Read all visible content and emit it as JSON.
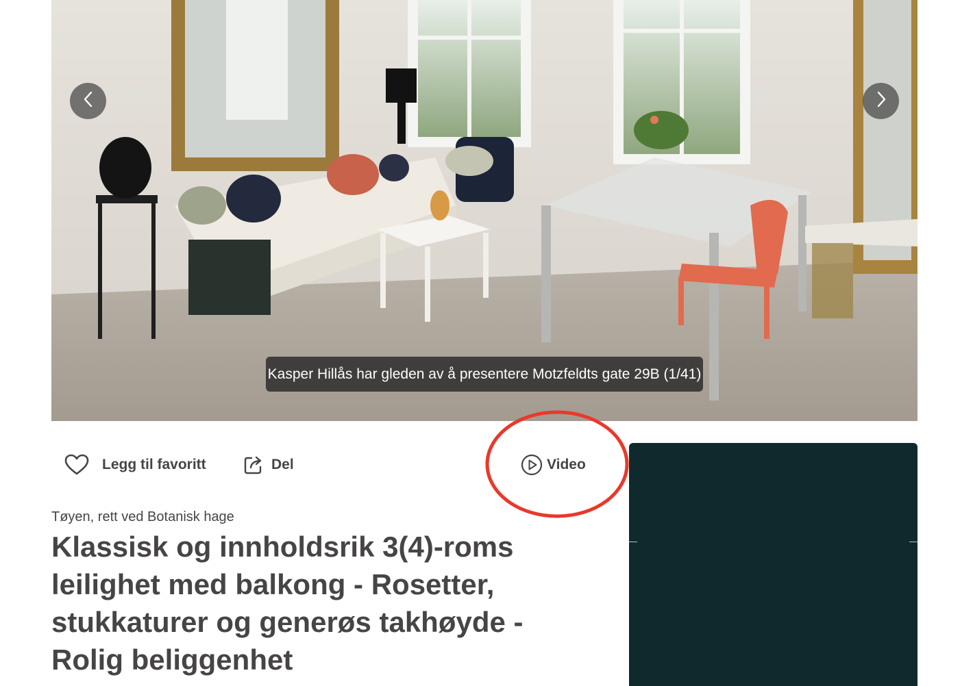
{
  "gallery": {
    "caption": "Kasper Hillås har gleden av å presentere Motzfeldts gate 29B (1/41)",
    "prev_icon": "chevron-left-icon",
    "next_icon": "chevron-right-icon"
  },
  "actions": {
    "favorite_label": "Legg til favoritt",
    "favorite_icon": "heart-icon",
    "share_label": "Del",
    "share_icon": "share-icon",
    "video_label": "Video",
    "video_icon": "play-icon"
  },
  "listing": {
    "location": "Tøyen, rett ved Botanisk hage",
    "title": "Klassisk og innholdsrik 3(4)-roms leilighet med balkong - Rosetter, stukkaturer og generøs takhøyde - Rolig beliggenhet"
  },
  "colors": {
    "text": "#474445",
    "panel": "#10292d",
    "annotation": "#e8392b",
    "caption_bg": "#2a2a2a"
  }
}
